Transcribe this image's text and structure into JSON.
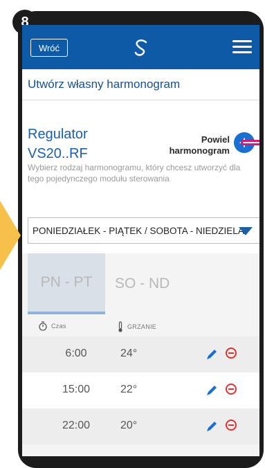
{
  "step": {
    "number": "8"
  },
  "header": {
    "back_label": "Wróć",
    "brand_color": "#0f5aa6"
  },
  "page": {
    "title": "Utwórz własny harmonogram"
  },
  "regulator": {
    "name_line1": "Regulator",
    "name_line2": "VS20..RF",
    "copy_label_line1": "Powiel",
    "copy_label_line2": "harmonogram",
    "description": "Wybierz rodzaj harmonogramu, który chcesz utworzyć dla tego pojedynczego modułu sterowania"
  },
  "schedule_type": {
    "selected": "PONIEDZIAŁEK - PIĄTEK / SOBOTA - NIEDZIELA"
  },
  "tabs": [
    {
      "label": "PN - PT",
      "active": true
    },
    {
      "label": "SO - ND",
      "active": false
    }
  ],
  "columns": {
    "time": "Czas",
    "heating": "GRZANIE"
  },
  "rows": [
    {
      "time": "6:00",
      "temp": "24°"
    },
    {
      "time": "15:00",
      "temp": "22°"
    },
    {
      "time": "22:00",
      "temp": "20°"
    }
  ],
  "colors": {
    "accent": "#1b6fd1",
    "delete": "#e03030",
    "highlight": "#d61a75",
    "callout": "#f7c04a"
  }
}
